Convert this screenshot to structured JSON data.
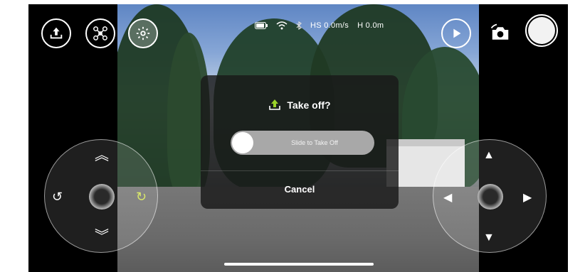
{
  "top_controls": {
    "left": [
      {
        "name": "takeoff-button",
        "icon": "takeoff-upload-icon"
      },
      {
        "name": "drone-mode-button",
        "icon": "drone-icon"
      },
      {
        "name": "settings-button",
        "icon": "gear-icon"
      }
    ],
    "right": [
      {
        "name": "playback-button",
        "icon": "play-icon"
      },
      {
        "name": "camera-switch-button",
        "icon": "camera-icon"
      },
      {
        "name": "shutter-button",
        "icon": "shutter-icon"
      }
    ]
  },
  "status": {
    "hs_label": "HS",
    "hs_value": "0.0m/s",
    "h_label": "H",
    "h_value": "0.0m"
  },
  "dialog": {
    "title": "Take off?",
    "slider_label": "Slide to Take Off",
    "cancel_label": "Cancel"
  }
}
